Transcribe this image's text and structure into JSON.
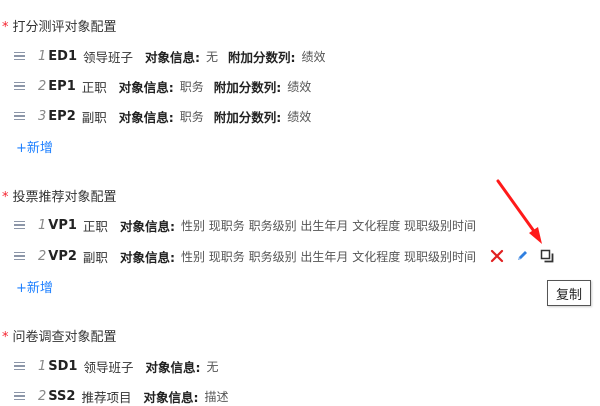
{
  "colors": {
    "accent": "#1e80ff",
    "required": "#f5222d",
    "delete": "#e02020",
    "annotation_arrow": "#ff1a1a"
  },
  "sections": [
    {
      "title": "打分测评对象配置",
      "required_mark": "*",
      "add_label": "+新增",
      "rows": [
        {
          "index": "1",
          "code": "ED1",
          "name": "领导班子",
          "info_label": "对象信息:",
          "info_value": "无",
          "extra_label": "附加分数列:",
          "extra_value": "绩效"
        },
        {
          "index": "2",
          "code": "EP1",
          "name": "正职",
          "info_label": "对象信息:",
          "info_value": "职务",
          "extra_label": "附加分数列:",
          "extra_value": "绩效"
        },
        {
          "index": "3",
          "code": "EP2",
          "name": "副职",
          "info_label": "对象信息:",
          "info_value": "职务",
          "extra_label": "附加分数列:",
          "extra_value": "绩效"
        }
      ]
    },
    {
      "title": "投票推荐对象配置",
      "required_mark": "*",
      "add_label": "+新增",
      "rows": [
        {
          "index": "1",
          "code": "VP1",
          "name": "正职",
          "info_label": "对象信息:",
          "info_value": "性别 现职务 职务级别 出生年月 文化程度 现职级别时间"
        },
        {
          "index": "2",
          "code": "VP2",
          "name": "副职",
          "info_label": "对象信息:",
          "info_value": "性别 现职务 职务级别 出生年月 文化程度 现职级别时间"
        }
      ]
    },
    {
      "title": "问卷调查对象配置",
      "required_mark": "*",
      "rows": [
        {
          "index": "1",
          "code": "SD1",
          "name": "领导班子",
          "info_label": "对象信息:",
          "info_value": "无"
        },
        {
          "index": "2",
          "code": "SS2",
          "name": "推荐项目",
          "info_label": "对象信息:",
          "info_value": "描述"
        }
      ]
    }
  ],
  "row_actions": {
    "delete_icon": "close-icon",
    "edit_icon": "pencil-icon",
    "copy_icon": "copy-icon"
  },
  "tooltip": {
    "text": "复制"
  }
}
